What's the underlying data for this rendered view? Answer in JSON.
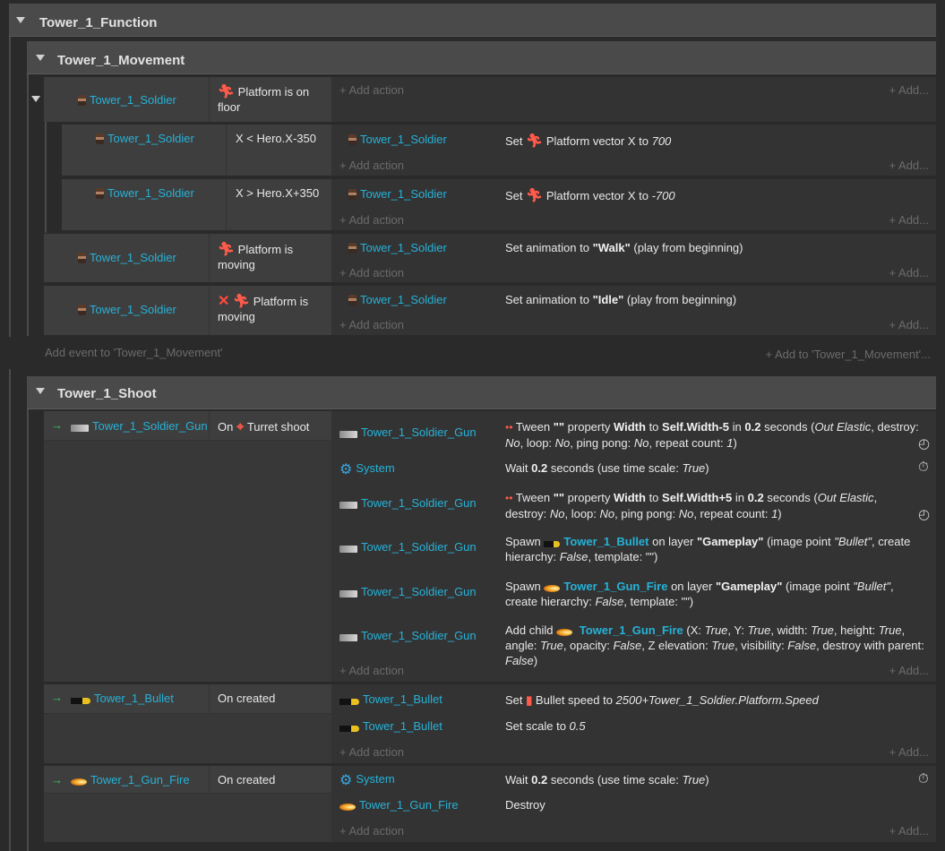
{
  "groups": {
    "function": "Tower_1_Function",
    "movement": "Tower_1_Movement",
    "shoot": "Tower_1_Shoot"
  },
  "placeholders": {
    "add_action": "+ Add action",
    "add_more": "+ Add..."
  },
  "footer": {
    "add_event": "Add event to 'Tower_1_Movement'",
    "add_to": "+ Add to 'Tower_1_Movement'..."
  },
  "objects": {
    "soldier": "Tower_1_Soldier",
    "gun": "Tower_1_Soldier_Gun",
    "bullet": "Tower_1_Bullet",
    "fire": "Tower_1_Gun_Fire",
    "system": "System"
  },
  "movement": {
    "e1": {
      "cond": "Platform is on floor"
    },
    "e2": {
      "cond": "X < Hero.X-350",
      "act_pre": "Set",
      "act": "Platform vector X to",
      "val": "700"
    },
    "e3": {
      "cond": "X > Hero.X+350",
      "act_pre": "Set",
      "act": "Platform vector X to",
      "val": "-700"
    },
    "e4": {
      "cond": "Platform is moving",
      "act_a": "Set animation to ",
      "anim": "\"Walk\"",
      "act_b": " (play from beginning)"
    },
    "e5": {
      "cond": "Platform is moving",
      "act_a": "Set animation to ",
      "anim": "\"Idle\"",
      "act_b": " (play from beginning)"
    }
  },
  "shoot": {
    "e1": {
      "cond_pre": "On",
      "cond": "Turret shoot",
      "a1": {
        "t1": "Tween ",
        "q": "\"\"",
        "t2": " property ",
        "p": "Width",
        "t3": " to ",
        "v": "Self.Width-5",
        "t4": " in ",
        "d": "0.2",
        "t5": " seconds (",
        "e": "Out Elastic",
        "t6": ", destroy: ",
        "no1": "No",
        "t7": ", loop: ",
        "no2": "No",
        "t8": ", ping pong: ",
        "no3": "No",
        "t9": ", repeat count: ",
        "one": "1",
        "t10": ")"
      },
      "a2": {
        "t1": "Wait ",
        "d": "0.2",
        "t2": " seconds (use time scale: ",
        "v": "True",
        "t3": ")"
      },
      "a3": {
        "t1": "Tween ",
        "q": "\"\"",
        "t2": " property ",
        "p": "Width",
        "t3": " to ",
        "v": "Self.Width+5",
        "t4": " in ",
        "d": "0.2",
        "t5": " seconds (",
        "e": "Out Elastic",
        "t6": ",",
        "t6b": "destroy: ",
        "no1": "No",
        "t7": ", loop: ",
        "no2": "No",
        "t8": ", ping pong: ",
        "no3": "No",
        "t9": ", repeat count: ",
        "one": "1",
        "t10": ")"
      },
      "a4": {
        "t1": "Spawn ",
        "obj": "Tower_1_Bullet",
        "t2": " on layer ",
        "layer": "\"Gameplay\"",
        "t3": " (image point ",
        "pt": "\"Bullet\"",
        "t4": ", create",
        "t5": "hierarchy: ",
        "f": "False",
        "t6": ", template: \"\")"
      },
      "a5": {
        "t1": "Spawn ",
        "obj": "Tower_1_Gun_Fire",
        "t2": " on layer ",
        "layer": "\"Gameplay\"",
        "t3": " (image point ",
        "pt": "\"Bullet\"",
        "t4": ", create",
        "t5": "hierarchy: ",
        "f": "False",
        "t6": ", template: \"\")"
      },
      "a6": {
        "t1": "Add child ",
        "obj": "Tower_1_Gun_Fire",
        "t2": " (X: ",
        "x": "True",
        "t3": ", Y: ",
        "y": "True",
        "t4": ", width: ",
        "w": "True",
        "t5": ", height: ",
        "h": "True",
        "t6": ", angle:",
        "a": "True",
        "t7": ", opacity: ",
        "o": "False",
        "t8": ", Z elevation: ",
        "z": "True",
        "t9": ", visibility: ",
        "vis": "False",
        "t10": ", destroy with parent: ",
        "dp": "False",
        "t11": ")"
      }
    },
    "e2": {
      "cond": "On created",
      "a1_pre": "Set",
      "a1": "Bullet speed to ",
      "a1v": "2500+Tower_1_Soldier.Platform.Speed",
      "a2": "Set scale to ",
      "a2v": "0.5"
    },
    "e3": {
      "cond": "On created",
      "a1": "Wait ",
      "a1d": "0.2",
      "a1b": " seconds (use time scale: ",
      "a1v": "True",
      "a1c": ")",
      "a2": "Destroy"
    }
  }
}
